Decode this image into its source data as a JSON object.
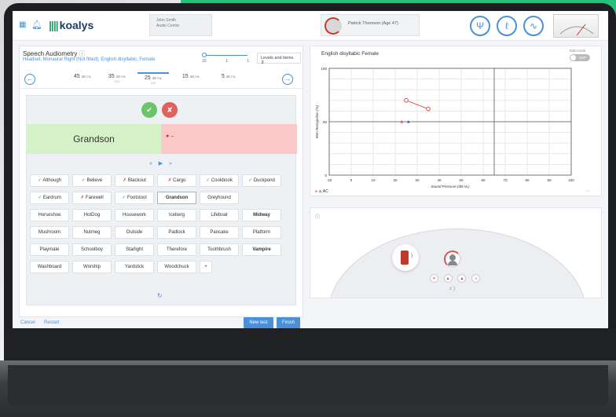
{
  "colors": {
    "accent": "#4a90d9",
    "ok": "#3aa857",
    "bad": "#d9534f",
    "brand_green": "#25c07a"
  },
  "topbar": {
    "logo": "koalys",
    "user_name": "John Smith",
    "user_sub": "Audio Centre",
    "patient": "Patrick Thomson (Age 47)",
    "tools": [
      "tuning-fork-icon",
      "ear-icon",
      "audiogram-icon"
    ]
  },
  "speech": {
    "title": "Speech Audiometry",
    "info_icon": "ⓘ",
    "subtitle": "Headset, Monaural Right (Not fitted), English disyllabic, Female",
    "slider_values": [
      "10",
      "1",
      "1"
    ],
    "levels_label": "Levels and items",
    "levels": [
      {
        "value": "45",
        "unit": "dB HL",
        "sub": ""
      },
      {
        "value": "35",
        "unit": "dB HL",
        "sub": "2/12"
      },
      {
        "value": "25",
        "unit": "dB HL",
        "sub": "6/8"
      },
      {
        "value": "15",
        "unit": "dB HL",
        "sub": ""
      },
      {
        "value": "5",
        "unit": "dB HL",
        "sub": ""
      }
    ],
    "current_word": "Grandson",
    "wrong_placeholder": "–",
    "playback": "« ▶ »",
    "words": [
      {
        "t": "Although",
        "s": "ok"
      },
      {
        "t": "Believe",
        "s": "ok"
      },
      {
        "t": "Blackout",
        "s": "bad"
      },
      {
        "t": "Cargo",
        "s": "bad"
      },
      {
        "t": "Cookbook",
        "s": "ok"
      },
      {
        "t": "Duckpond",
        "s": "ok"
      },
      {
        "t": "Eardrum",
        "s": "ok"
      },
      {
        "t": "Farewell",
        "s": "bad"
      },
      {
        "t": "Footstool",
        "s": "ok"
      },
      {
        "t": "Grandson",
        "s": "sel"
      },
      {
        "t": "Greyhound",
        "s": ""
      },
      {
        "t": "Horseshoe",
        "s": ""
      },
      {
        "t": "HotDog",
        "s": ""
      },
      {
        "t": "Housework",
        "s": ""
      },
      {
        "t": "Iceberg",
        "s": ""
      },
      {
        "t": "Lifeboat",
        "s": ""
      },
      {
        "t": "Midway",
        "s": "bold"
      },
      {
        "t": "Mushroom",
        "s": ""
      },
      {
        "t": "Nutmeg",
        "s": ""
      },
      {
        "t": "Outside",
        "s": ""
      },
      {
        "t": "Padlock",
        "s": ""
      },
      {
        "t": "Pancake",
        "s": ""
      },
      {
        "t": "Platform",
        "s": ""
      },
      {
        "t": "Playmate",
        "s": ""
      },
      {
        "t": "Schoolboy",
        "s": ""
      },
      {
        "t": "Starlight",
        "s": ""
      },
      {
        "t": "Therefore",
        "s": ""
      },
      {
        "t": "Toothbrush",
        "s": ""
      },
      {
        "t": "Vampire",
        "s": "bold"
      },
      {
        "t": "Washboard",
        "s": ""
      },
      {
        "t": "Worship",
        "s": ""
      },
      {
        "t": "Yardstick",
        "s": ""
      },
      {
        "t": "Woodchuck",
        "s": ""
      },
      {
        "t": "+",
        "s": "add"
      }
    ],
    "cancel": "Cancel",
    "restart": "Restart",
    "new_test": "New test",
    "finish": "Finish"
  },
  "chart_panel": {
    "title": "English disyllabic Female",
    "edit_mode": "Edit mode",
    "toggle": "OFF",
    "legend": "AC"
  },
  "chart_data": {
    "type": "line",
    "xlabel": "Sound Pressure (dB HL)",
    "ylabel": "Item Recognition (%)",
    "xlim": [
      -10,
      100
    ],
    "ylim": [
      0,
      100
    ],
    "xticks": [
      -10,
      0,
      10,
      20,
      30,
      40,
      50,
      60,
      70,
      80,
      90,
      100
    ],
    "yticks": [
      0,
      50,
      100
    ],
    "series": [
      {
        "x": [
          25,
          35
        ],
        "y": [
          70,
          62
        ],
        "color": "#d9534f"
      }
    ],
    "markers": [
      {
        "x": 23,
        "y": 50,
        "color": "#d9534f",
        "shape": "triangle"
      },
      {
        "x": 26,
        "y": 50,
        "color": "#3b5bdb",
        "shape": "triangle"
      }
    ],
    "reference_x": 65
  }
}
